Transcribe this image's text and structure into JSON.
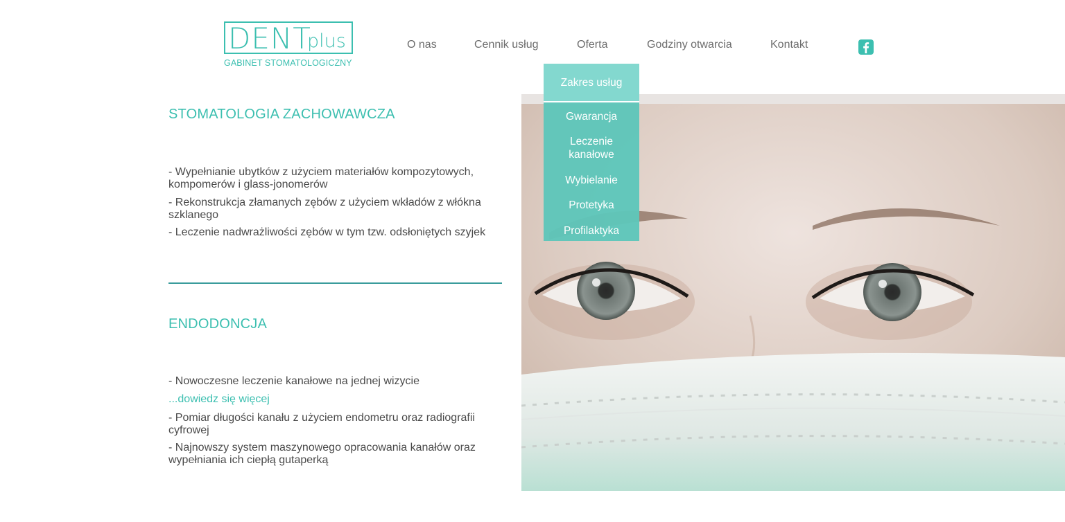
{
  "logo": {
    "main": "DENT",
    "suffix": "plus",
    "subtitle": "GABINET STOMATOLOGICZNY"
  },
  "nav": {
    "items": [
      {
        "label": "O nas"
      },
      {
        "label": "Cennik usług"
      },
      {
        "label": "Oferta"
      },
      {
        "label": "Godziny otwarcia"
      },
      {
        "label": "Kontakt"
      }
    ],
    "facebook_icon": "facebook-icon"
  },
  "dropdown": {
    "top_item": "Zakres usług",
    "items": [
      {
        "label": "Gwarancja"
      },
      {
        "label": "Leczenie kanałowe"
      },
      {
        "label": "Wybielanie"
      },
      {
        "label": "Protetyka"
      },
      {
        "label": "Profilaktyka"
      }
    ]
  },
  "sections": [
    {
      "title": "STOMATOLOGIA ZACHOWAWCZA",
      "items": [
        "- Wypełnianie ubytków z użyciem materiałów kompozytowych, kompomerów i glass-jonomerów",
        "- Rekonstrukcja złamanych zębów z użyciem wkładów z włókna szklanego",
        "- Leczenie nadwrażliwości zębów w tym tzw. odsłoniętych szyjek"
      ]
    },
    {
      "title": "ENDODONCJA",
      "items": [
        "- Nowoczesne leczenie kanałowe na jednej wizycie",
        "- Pomiar długości kanału z użyciem endometru oraz radiografii cyfrowej",
        "- Najnowszy system maszynowego opracowania kanałów oraz wypełniania ich ciepłą gutaperką"
      ],
      "link": "...dowiedz się więcej"
    }
  ],
  "colors": {
    "accent": "#3cbfb0",
    "dropdown_bg": "#5fc6b9",
    "text": "#4a4a4a",
    "nav_text": "#6d6d6d"
  }
}
